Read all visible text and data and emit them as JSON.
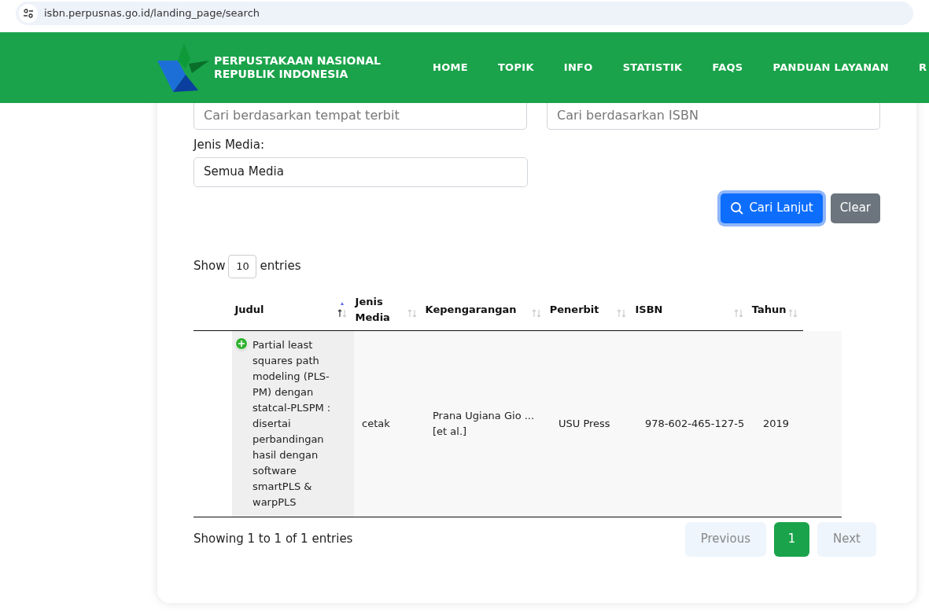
{
  "browser": {
    "url": "isbn.perpusnas.go.id/landing_page/search"
  },
  "header": {
    "logo_line_1": "PERPUSTAKAAN NASIONAL",
    "logo_line_2": "REPUBLIK INDONESIA",
    "nav": [
      "HOME",
      "TOPIK",
      "INFO",
      "STATISTIK",
      "FAQS",
      "PANDUAN LAYANAN",
      "R"
    ]
  },
  "search_form": {
    "fields": [
      {
        "placeholder": "Cari berdasarkan tempat terbit"
      },
      {
        "placeholder": "Cari berdasarkan ISBN"
      }
    ],
    "media_label": "Jenis Media:",
    "media_value": "Semua Media",
    "search_button": "Cari Lanjut",
    "clear_button": "Clear"
  },
  "table": {
    "length_label_before": "Show",
    "length_value": "10",
    "length_label_after": "entries",
    "columns": [
      {
        "label": "Judul",
        "sorted": true
      },
      {
        "label": "Jenis Media",
        "sorted": false
      },
      {
        "label": "Kepengarangan",
        "sorted": false
      },
      {
        "label": "Penerbit",
        "sorted": false
      },
      {
        "label": "ISBN",
        "sorted": false
      },
      {
        "label": "Tahun",
        "sorted": false
      }
    ],
    "rows": [
      {
        "expanded": false,
        "cells": [
          "Partial least squares path modeling (PLS-PM) dengan statcal-PLSPM : disertai perbandingan hasil dengan software smartPLS & warpPLS",
          "cetak",
          "Prana Ugiana Gio ... [et al.]",
          "USU Press",
          "978-602-465-127-5",
          "2019"
        ]
      }
    ],
    "info": "Showing 1 to 1 of 1 entries",
    "pagination": [
      {
        "label": "Previous",
        "kind": "nav",
        "disabled": true,
        "selected": false
      },
      {
        "label": "1",
        "kind": "page",
        "disabled": false,
        "selected": true
      },
      {
        "label": "Next",
        "kind": "nav",
        "disabled": true,
        "selected": false
      }
    ]
  }
}
